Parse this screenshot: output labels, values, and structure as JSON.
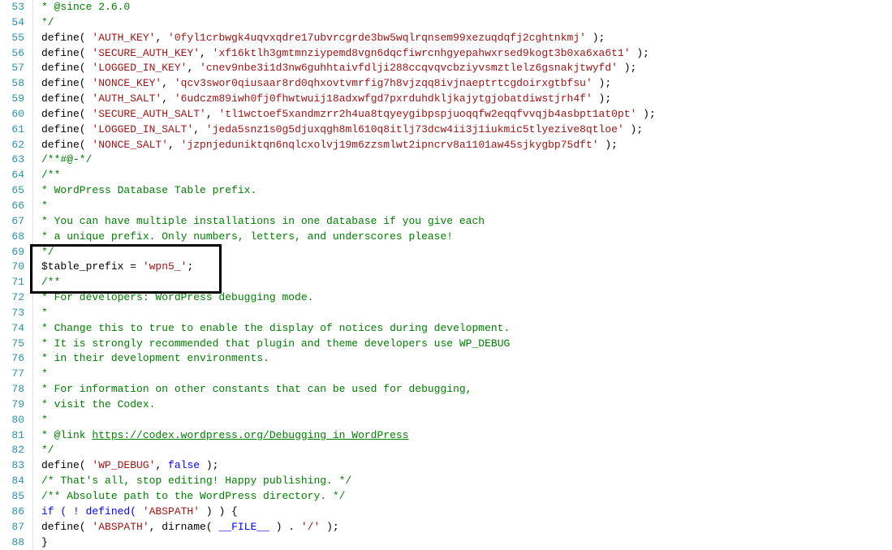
{
  "startLine": 53,
  "gutter": [
    "53",
    "54",
    "55",
    "56",
    "57",
    "58",
    "59",
    "60",
    "61",
    "62",
    "63",
    "64",
    "65",
    "66",
    "67",
    "68",
    "69",
    "70",
    "71",
    "72",
    "73",
    "74",
    "75",
    "76",
    "77",
    "78",
    "79",
    "80",
    "81",
    "82",
    "83",
    "84",
    "85",
    "86",
    "87",
    "88"
  ],
  "c53": " * @since 2.6.0",
  "c54": " */",
  "d55a": "define( ",
  "d55k": "'AUTH_KEY'",
  "d55p": ",         ",
  "d55v": "'0fyl1crbwgk4uqvxqdre17ubvrcgrde3bw5wqlrqnsem99xezuqdqfj2cghtnkmj'",
  "d55e": " );",
  "d56a": "define( ",
  "d56k": "'SECURE_AUTH_KEY'",
  "d56p": ",  ",
  "d56v": "'xf16ktlh3gmtmnziypemd8vgn6dqcfiwrcnhgyepahwxrsed9kogt3b0xa6xa6t1'",
  "d56e": " );",
  "d57a": "define( ",
  "d57k": "'LOGGED_IN_KEY'",
  "d57p": ",    ",
  "d57v": "'cnev9nbe3i1d3nw6guhhtaivfdlji288ccqvqvcbziyvsmztlelz6gsnakjtwyfd'",
  "d57e": " );",
  "d58a": "define( ",
  "d58k": "'NONCE_KEY'",
  "d58p": ",        ",
  "d58v": "'qcv3swor0qiusaar8rd0qhxovtvmrfig7h8vjzqq8ivjnaeptrtcgdoirxgtbfsu'",
  "d58e": " );",
  "d59a": "define( ",
  "d59k": "'AUTH_SALT'",
  "d59p": ",        ",
  "d59v": "'6udczm89iwh0fj0fhwtwuij18adxwfgd7pxrduhdkljkajytgjobatdiwstjrh4f'",
  "d59e": " );",
  "d60a": "define( ",
  "d60k": "'SECURE_AUTH_SALT'",
  "d60p": ", ",
  "d60v": "'tl1wctoef5xandmzrr2h4ua8tqyeygibpspjuoqqfw2eqqfvvqjb4asbpt1at0pt'",
  "d60e": " );",
  "d61a": "define( ",
  "d61k": "'LOGGED_IN_SALT'",
  "d61p": ",   ",
  "d61v": "'jeda5snz1s0g5djuxqgh8ml610q8itlj73dcw4ii3j1iukmic5tlyezive8qtloe'",
  "d61e": " );",
  "d62a": "define( ",
  "d62k": "'NONCE_SALT'",
  "d62p": ",       ",
  "d62v": "'jzpnjeduniktqn6nqlcxolvj19m6zzsmlwt2ipncrv8a1101aw45sjkygbp75dft'",
  "d62e": " );",
  "c63": "/**#@-*/",
  "c64": "/**",
  "c65": " * WordPress Database Table prefix.",
  "c66": " *",
  "c67": " * You can have multiple installations in one database if you give each",
  "c68": " * a unique prefix. Only numbers, letters, and underscores please!",
  "c69": " */",
  "v70a": "$table_prefix = ",
  "v70b": "'wpn5_'",
  "v70c": ";",
  "c71": "/**",
  "c72": " * For developers: WordPress debugging mode.",
  "c73": " *",
  "c74": " * Change this to true to enable the display of notices during development.",
  "c75": " * It is strongly recommended that plugin and theme developers use WP_DEBUG",
  "c76": " * in their development environments.",
  "c77": " *",
  "c78": " * For information on other constants that can be used for debugging,",
  "c79": " * visit the Codex.",
  "c80": " *",
  "c81a": " * @link ",
  "c81b": "https://codex.wordpress.org/Debugging_in_WordPress",
  "c82": " */",
  "d83a": "define( ",
  "d83k": "'WP_DEBUG'",
  "d83p": ", ",
  "d83v": "false",
  "d83e": " );",
  "c84": "/* That's all, stop editing! Happy publishing. */",
  "c85": "/** Absolute path to the WordPress directory. */",
  "i86a": "if ( ! defined( ",
  "i86b": "'ABSPATH'",
  "i86c": " ) ) {",
  "i87a": "    define( ",
  "i87b": "'ABSPATH'",
  "i87c": ", dirname( ",
  "i87d": "__FILE__",
  "i87e": " ) . ",
  "i87f": "'/'",
  "i87g": " );",
  "i88": "}"
}
